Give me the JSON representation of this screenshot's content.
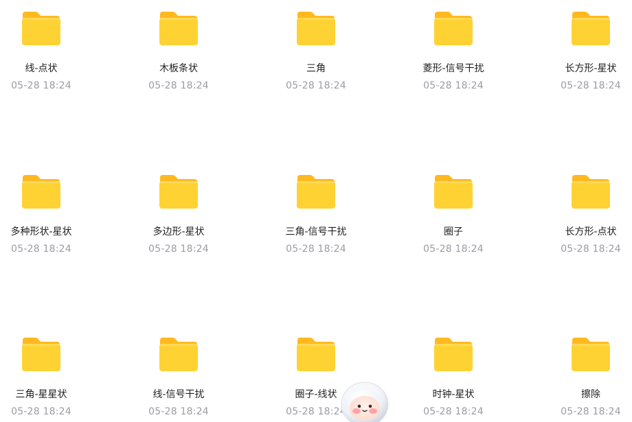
{
  "colors": {
    "folder_body": "#FFD234",
    "folder_tab": "#FFB91F",
    "name_text": "#1F1F1F",
    "date_text": "#9A9CA3",
    "background": "#FFFFFF"
  },
  "folders": [
    {
      "name": "线-点状",
      "date": "05-28 18:24",
      "icon": "folder-icon"
    },
    {
      "name": "木板条状",
      "date": "05-28 18:24",
      "icon": "folder-icon"
    },
    {
      "name": "三角",
      "date": "05-28 18:24",
      "icon": "folder-icon"
    },
    {
      "name": "菱形-信号干扰",
      "date": "05-28 18:24",
      "icon": "folder-icon"
    },
    {
      "name": "长方形-星状",
      "date": "05-28 18:24",
      "icon": "folder-icon"
    },
    {
      "name": "多种形状-星状",
      "date": "05-28 18:24",
      "icon": "folder-icon"
    },
    {
      "name": "多边形-星状",
      "date": "05-28 18:24",
      "icon": "folder-icon"
    },
    {
      "name": "三角-信号干扰",
      "date": "05-28 18:24",
      "icon": "folder-icon"
    },
    {
      "name": "圈子",
      "date": "05-28 18:24",
      "icon": "folder-icon"
    },
    {
      "name": "长方形-点状",
      "date": "05-28 18:24",
      "icon": "folder-icon"
    },
    {
      "name": "三角-星星状",
      "date": "05-28 18:24",
      "icon": "folder-icon"
    },
    {
      "name": "线-信号干扰",
      "date": "05-28 18:24",
      "icon": "folder-icon"
    },
    {
      "name": "圈子-线状",
      "date": "05-28 18:24",
      "icon": "folder-icon"
    },
    {
      "name": "时钟-星状",
      "date": "05-28 18:24",
      "icon": "folder-icon"
    },
    {
      "name": "擦除",
      "date": "05-28 18:24",
      "icon": "folder-icon"
    }
  ],
  "assistant": {
    "icon": "assistant-mascot-icon"
  }
}
